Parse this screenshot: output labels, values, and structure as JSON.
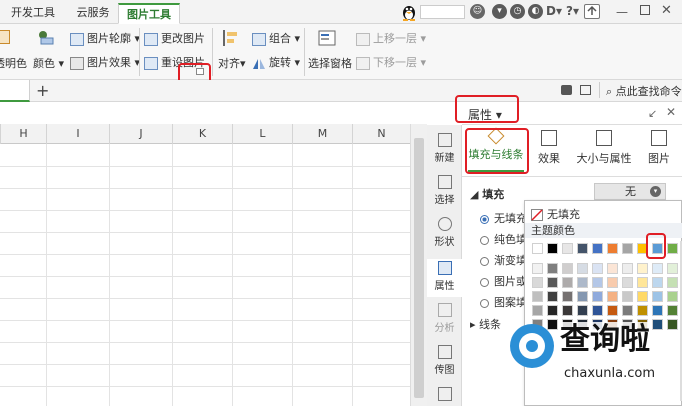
{
  "tabs": [
    "开发工具",
    "云服务",
    "图片工具"
  ],
  "topbar_icons": [
    "qq-penguin-icon",
    "emoji-icon",
    "arrow-icon",
    "history-icon",
    "font-icon",
    "help-icon",
    "more-icon",
    "export-icon",
    "minimize-icon",
    "restore-icon",
    "close-icon"
  ],
  "ribbon": {
    "transparent_color": "透明色",
    "color": "颜色",
    "outline": "图片轮廓",
    "effect": "图片效果",
    "change_pic": "更改图片",
    "reset_pic": "重设图片",
    "align": "对齐",
    "group": "组合",
    "rotate": "旋转",
    "select_pane": "选择窗格",
    "bring_forward": "上移一层",
    "send_backward": "下移一层"
  },
  "sheet": {
    "add_label": "+"
  },
  "columns": [
    "H",
    "I",
    "J",
    "K",
    "L",
    "M",
    "N"
  ],
  "search_hint": "点此查找命令",
  "panel": {
    "title": "属性",
    "tabs": [
      "填充与线条",
      "效果",
      "大小与属性",
      "图片"
    ],
    "fill_section": "填充",
    "fill_value": "无",
    "fill_options": [
      "无填充",
      "纯色填",
      "渐变填",
      "图片或",
      "图案填"
    ],
    "line_section": "线条"
  },
  "sidebar": [
    "新建",
    "选择",
    "形状",
    "属性",
    "分析",
    "传图",
    "备份"
  ],
  "popup": {
    "no_fill": "无填充",
    "theme_colors": "主题颜色",
    "top_row": [
      "#ffffff",
      "#000000",
      "#e7e6e6",
      "#44546a",
      "#4472c4",
      "#ed7d31",
      "#a5a5a5",
      "#ffc000",
      "#5b9bd5",
      "#70ad47"
    ],
    "shades": [
      [
        "#f2f2f2",
        "#7f7f7f",
        "#d0cece",
        "#d6dce4",
        "#dae3f3",
        "#fbe5d6",
        "#ededed",
        "#fff2cc",
        "#deebf7",
        "#e2f0d9"
      ],
      [
        "#d9d9d9",
        "#595959",
        "#aeabab",
        "#adb9ca",
        "#b4c7e7",
        "#f8cbad",
        "#dbdbdb",
        "#ffe699",
        "#bdd7ee",
        "#c5e0b4"
      ],
      [
        "#bfbfbf",
        "#404040",
        "#757171",
        "#8497b0",
        "#8faadc",
        "#f4b183",
        "#c9c9c9",
        "#ffd966",
        "#9dc3e6",
        "#a9d18e"
      ],
      [
        "#a6a6a6",
        "#262626",
        "#3b3838",
        "#333f50",
        "#2f5597",
        "#c55a11",
        "#7b7b7b",
        "#bf9000",
        "#2e75b6",
        "#538135"
      ],
      [
        "#808080",
        "#0d0d0d",
        "#171616",
        "#222a35",
        "#203864",
        "#843c0c",
        "#525252",
        "#7f6000",
        "#1f4e79",
        "#385723"
      ]
    ]
  },
  "watermark": {
    "name": "查询啦",
    "url": "chaxunla.com"
  },
  "colors": {
    "accent_green": "#3f9a3f",
    "highlight_red": "#e01e25"
  }
}
